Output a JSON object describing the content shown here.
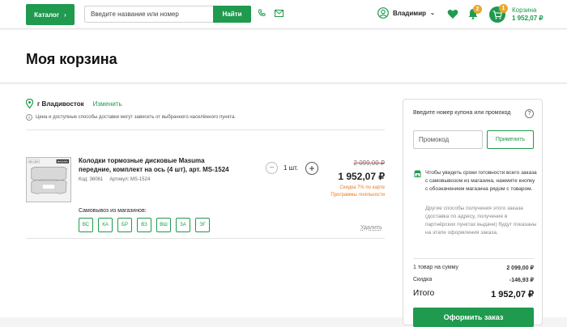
{
  "header": {
    "catalog_label": "Каталог",
    "search_placeholder": "Введите название или номер",
    "search_button": "Найти",
    "user_name": "Владимир",
    "notifications_count": "2",
    "cart_count": "1",
    "cart_label": "Корзина",
    "cart_total": "1 952,07 ₽"
  },
  "page": {
    "title": "Моя корзина"
  },
  "location": {
    "city": "г Владивосток",
    "change_link": "Изменить",
    "note": "Цена и доступные способы доставки могут зависеть от выбранного населённого пункта."
  },
  "item": {
    "name": "Колодки тормозные дисковые Masuma передние, комплект на ось (4 шт), арт. MS-1524",
    "code": "Код: 36061",
    "article": "Артикул: MS-1524",
    "image_brand": "MASUMA",
    "image_code": "MS-1524",
    "quantity": "1 шт.",
    "old_price": "2 099,00 ₽",
    "new_price": "1 952,07 ₽",
    "discount_note": "Скидка 7% по карте",
    "loyalty_link": "Программы лояльности",
    "pickup_label": "Самовывоз из магазинов:",
    "stores": [
      "ВС",
      "КА",
      "БР",
      "ВЗ",
      "ВШ",
      "ЗА",
      "ЭГ"
    ],
    "delete_label": "Удалить"
  },
  "sidebar": {
    "coupon_label": "Введите номер купона или промокод",
    "promo_placeholder": "Промокод",
    "apply_button": "Применить",
    "info_primary": "Чтобы увидеть сроки готовности всего заказа с самовывозом из магазина, нажмите кнопку с обозначением магазина рядом с товаром.",
    "info_secondary": "Другие способы получения этого заказа (доставка по адресу, получение в партнёрских пунктах выдачи) будут показаны на этапе оформления заказа.",
    "summary": {
      "items_label": "1 товар на сумму",
      "items_value": "2 099,00 ₽",
      "discount_label": "Скидка",
      "discount_value": "-146,93 ₽",
      "total_label": "Итого",
      "total_value": "1 952,07 ₽"
    },
    "checkout_button": "Оформить заказ"
  },
  "colors": {
    "brand_green": "#1f9a4e",
    "badge_orange": "#e6a82c",
    "discount_orange": "#e67e22"
  }
}
